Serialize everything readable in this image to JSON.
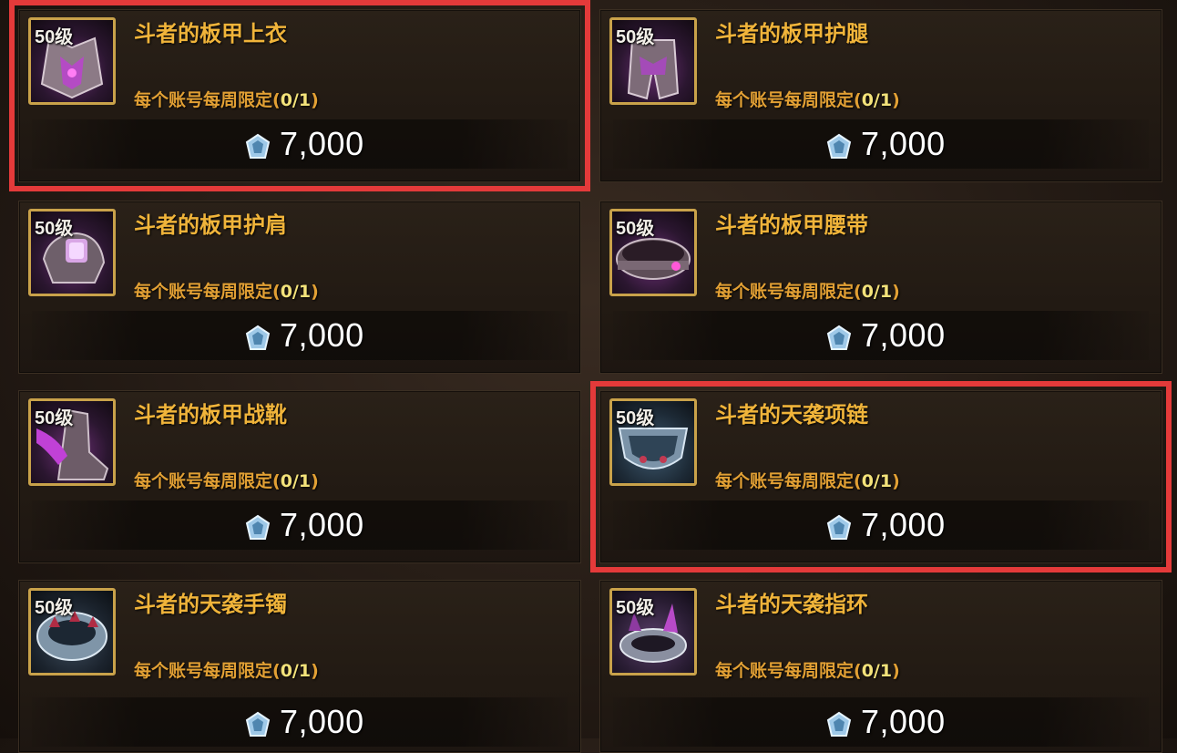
{
  "items": [
    {
      "level": "50级",
      "name": "斗者的板甲上衣",
      "limit_text": "每个账号每周限定(",
      "limit_count": "0/1",
      "limit_close": ")",
      "price": "7,000",
      "icon": "plate-chest-icon",
      "highlighted": true
    },
    {
      "level": "50级",
      "name": "斗者的板甲护腿",
      "limit_text": "每个账号每周限定(",
      "limit_count": "0/1",
      "limit_close": ")",
      "price": "7,000",
      "icon": "plate-legs-icon",
      "highlighted": false
    },
    {
      "level": "50级",
      "name": "斗者的板甲护肩",
      "limit_text": "每个账号每周限定(",
      "limit_count": "0/1",
      "limit_close": ")",
      "price": "7,000",
      "icon": "plate-shoulder-icon",
      "highlighted": false
    },
    {
      "level": "50级",
      "name": "斗者的板甲腰带",
      "limit_text": "每个账号每周限定(",
      "limit_count": "0/1",
      "limit_close": ")",
      "price": "7,000",
      "icon": "plate-belt-icon",
      "highlighted": false
    },
    {
      "level": "50级",
      "name": "斗者的板甲战靴",
      "limit_text": "每个账号每周限定(",
      "limit_count": "0/1",
      "limit_close": ")",
      "price": "7,000",
      "icon": "plate-boots-icon",
      "highlighted": false
    },
    {
      "level": "50级",
      "name": "斗者的天袭项链",
      "limit_text": "每个账号每周限定(",
      "limit_count": "0/1",
      "limit_close": ")",
      "price": "7,000",
      "icon": "necklace-icon",
      "highlighted": true
    },
    {
      "level": "50级",
      "name": "斗者的天袭手镯",
      "limit_text": "每个账号每周限定(",
      "limit_count": "0/1",
      "limit_close": ")",
      "price": "7,000",
      "icon": "bracelet-icon",
      "highlighted": false
    },
    {
      "level": "50级",
      "name": "斗者的天袭指环",
      "limit_text": "每个账号每周限定(",
      "limit_count": "0/1",
      "limit_close": ")",
      "price": "7,000",
      "icon": "ring-icon",
      "highlighted": false
    }
  ],
  "currency_icon": "crystal-currency-icon",
  "colors": {
    "highlight": "#e43a3a",
    "name": "#f0b43a",
    "limit": "#e2a034",
    "limit_count": "#f3e27a",
    "icon_frame": "#c9a24a"
  }
}
